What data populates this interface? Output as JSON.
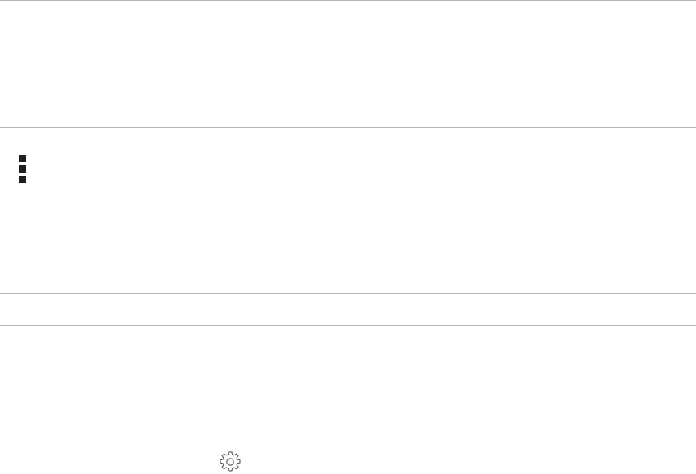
{
  "app": {
    "title": ""
  },
  "toolbar": {
    "menu_icon": "vertical-squares-menu-icon",
    "menu_label": ""
  },
  "footer": {
    "settings_icon": "gear-icon",
    "settings_label": ""
  },
  "colors": {
    "background": "#ffffff",
    "divider": "#b4b4b4",
    "icon": "#1e1e1e",
    "gear_stroke": "#555555"
  }
}
